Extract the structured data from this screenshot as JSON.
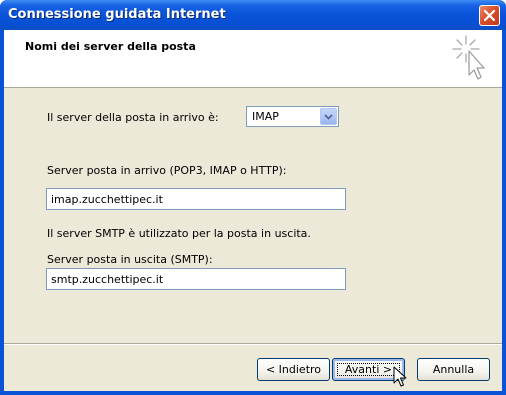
{
  "window": {
    "title": "Connessione guidata Internet"
  },
  "header": {
    "title": "Nomi dei server della posta",
    "icon": "wizard-sparkle-cursor-icon"
  },
  "form": {
    "incoming_type_label": "Il server della posta in arrivo è:",
    "incoming_type_value": "IMAP",
    "incoming_server_label": "Server posta in arrivo (POP3, IMAP o HTTP):",
    "incoming_server_value": "imap.zucchettipec.it",
    "smtp_info": "Il server SMTP è utilizzato per la posta in uscita.",
    "outgoing_server_label": "Server posta in uscita (SMTP):",
    "outgoing_server_value": "smtp.zucchettipec.it"
  },
  "buttons": {
    "back": "< Indietro",
    "next": "Avanti >",
    "cancel": "Annulla"
  },
  "colors": {
    "titlebar": "#0a54da",
    "client_bg": "#ece9d8",
    "close_button": "#d8512b",
    "button_border": "#003c74"
  }
}
